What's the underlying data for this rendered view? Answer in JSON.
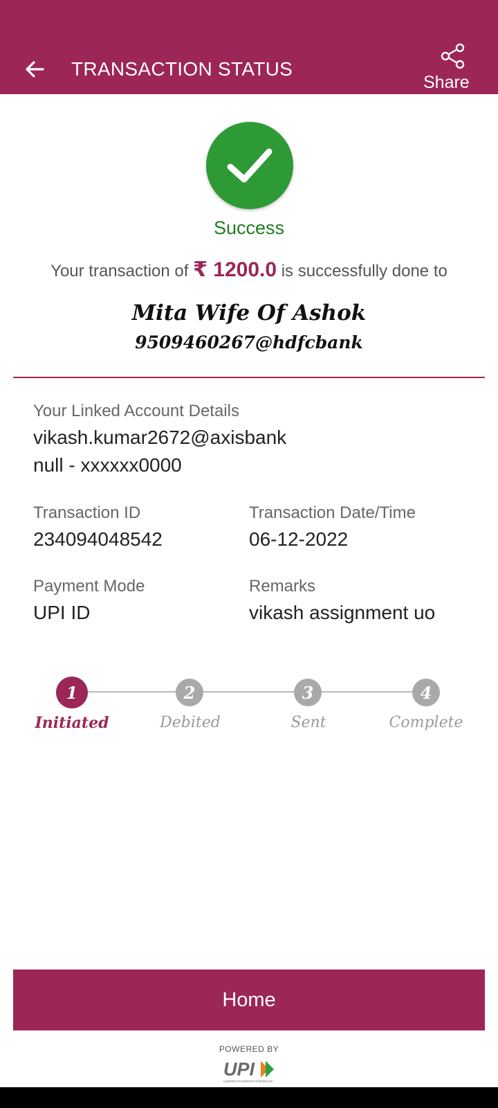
{
  "header": {
    "title": "TRANSACTION STATUS",
    "share_label": "Share"
  },
  "status": {
    "label": "Success",
    "color": "#2e9a36"
  },
  "summary": {
    "prefix": "Your transaction of",
    "currency": "₹",
    "amount": "1200.0",
    "suffix": "is successfully done to"
  },
  "payee": {
    "name": "Mita Wife Of Ashok",
    "upi_id": "9509460267@hdfcbank"
  },
  "linked_account": {
    "label": "Your Linked Account Details",
    "upi_id": "vikash.kumar2672@axisbank",
    "account": "null - xxxxxx0000"
  },
  "details": {
    "transaction_id_label": "Transaction ID",
    "transaction_id": "234094048542",
    "datetime_label": "Transaction Date/Time",
    "datetime": "06-12-2022",
    "payment_mode_label": "Payment Mode",
    "payment_mode": "UPI ID",
    "remarks_label": "Remarks",
    "remarks": "vikash assignment uo"
  },
  "steps": [
    {
      "number": "1",
      "label": "Initiated",
      "active": true
    },
    {
      "number": "2",
      "label": "Debited",
      "active": false
    },
    {
      "number": "3",
      "label": "Sent",
      "active": false
    },
    {
      "number": "4",
      "label": "Complete",
      "active": false
    }
  ],
  "home_button": {
    "label": "Home"
  },
  "footer": {
    "powered_by": "POWERED BY",
    "logo_text": "UPI",
    "logo_subtext": "UNIFIED PAYMENTS INTERFACE"
  },
  "colors": {
    "brand": "#9b2657",
    "success": "#2e9a36",
    "success_text": "#1f7d1f",
    "inactive": "#a9a9a9"
  },
  "icons": [
    "back-arrow-icon",
    "share-icon",
    "checkmark-icon",
    "upi-logo"
  ]
}
